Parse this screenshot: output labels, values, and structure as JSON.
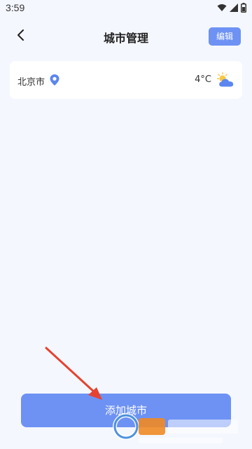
{
  "status_bar": {
    "time": "3:59",
    "icons": [
      "wifi-icon",
      "signal-icon",
      "battery-icon"
    ]
  },
  "header": {
    "back_icon": "chevron-left-icon",
    "title": "城市管理",
    "edit_label": "编辑"
  },
  "cities": [
    {
      "name": "北京市",
      "location_icon": "location-pin-icon",
      "temperature": "4°C",
      "weather_icon": "partly-cloudy-icon"
    }
  ],
  "footer": {
    "add_city_label": "添加城市"
  },
  "colors": {
    "accent": "#6d92f4",
    "background": "#f4f7fe",
    "card": "#ffffff",
    "annotation": "#e5432f"
  }
}
